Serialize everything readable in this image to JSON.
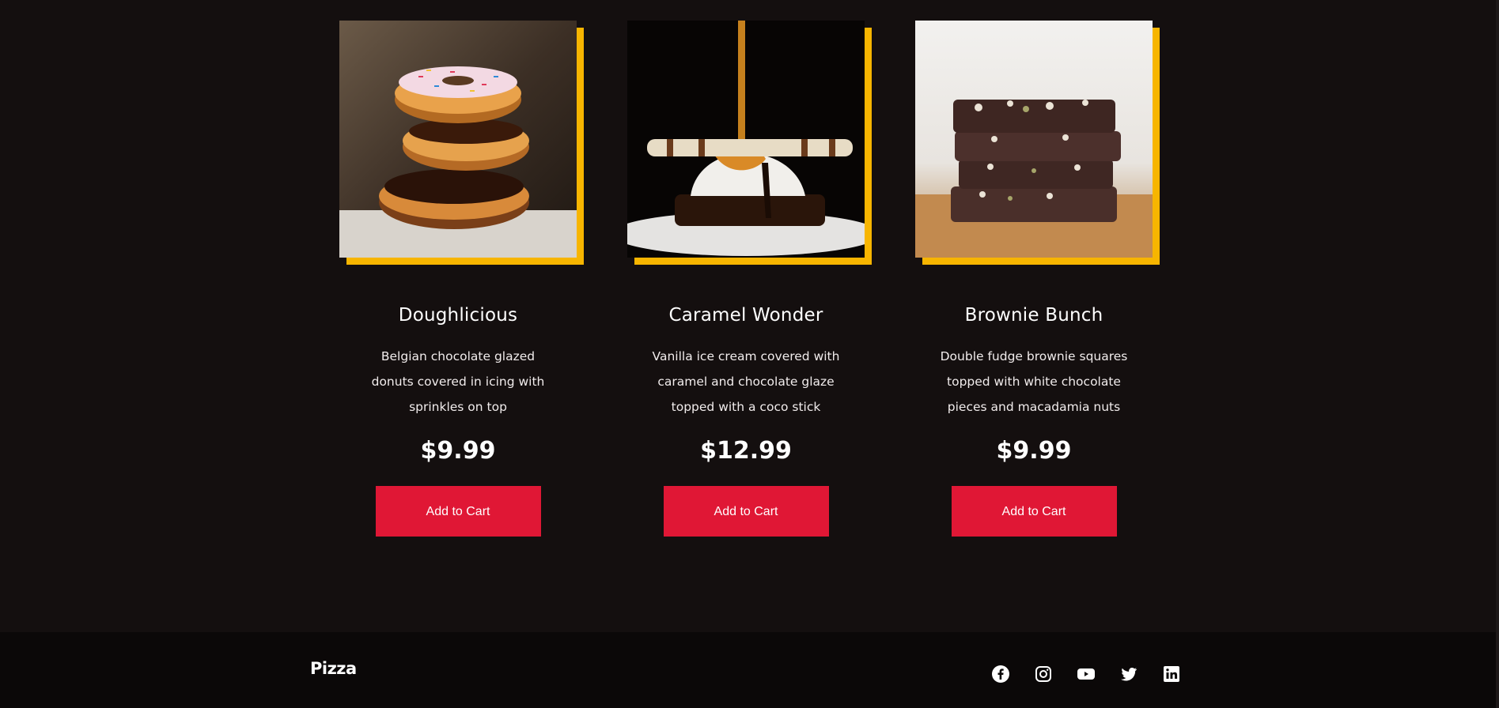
{
  "products": [
    {
      "image_name": "donut-stack-image",
      "title": "Doughlicious",
      "description": "Belgian chocolate glazed donuts covered in icing with sprinkles on top",
      "price": "$9.99",
      "cta": "Add to Cart"
    },
    {
      "image_name": "caramel-icecream-image",
      "title": "Caramel Wonder",
      "description": "Vanilla ice cream covered with caramel and chocolate glaze topped with a coco stick",
      "price": "$12.99",
      "cta": "Add to Cart"
    },
    {
      "image_name": "brownie-stack-image",
      "title": "Brownie Bunch",
      "description": "Double fudge brownie squares topped with white chocolate pieces and macadamia nuts",
      "price": "$9.99",
      "cta": "Add to Cart"
    }
  ],
  "footer": {
    "logo": "Pizza",
    "social": [
      "facebook-icon",
      "instagram-icon",
      "youtube-icon",
      "twitter-icon",
      "linkedin-icon"
    ]
  },
  "colors": {
    "background": "#140f0f",
    "footer_background": "#0b0808",
    "accent_yellow": "#f7b500",
    "button_red": "#e01735"
  }
}
